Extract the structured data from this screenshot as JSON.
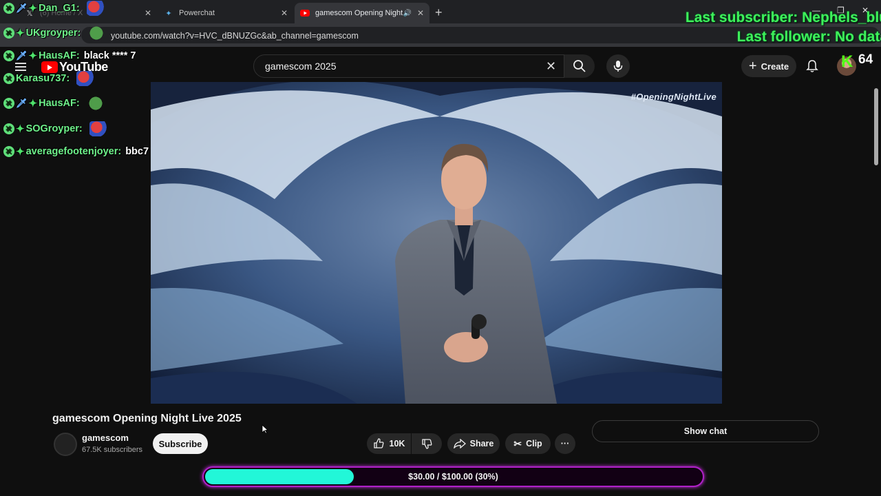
{
  "browser": {
    "tabs": [
      {
        "title": "(6) Home / X",
        "favicon": "x-icon"
      },
      {
        "title": "Powerchat",
        "favicon": "powerchat-icon"
      },
      {
        "title": "gamescom Opening Night",
        "favicon": "youtube-icon",
        "active": true
      }
    ],
    "url": "youtube.com/watch?v=HVC_dBNUZGc&ab_channel=gamescom"
  },
  "chat": [
    {
      "user": "Dan_G1:",
      "text": "",
      "emote": "mario"
    },
    {
      "user": "UKgroyper:",
      "text": "",
      "emote": "pepe"
    },
    {
      "user": "HausAF:",
      "text": "black **** 7",
      "emote": ""
    },
    {
      "user": "Karasu737:",
      "text": "",
      "emote": "mario"
    },
    {
      "user": "HausAF:",
      "text": "",
      "emote": "pepe"
    },
    {
      "user": "SOGroyper:",
      "text": "",
      "emote": "mario"
    },
    {
      "user": "averagefootenjoyer:",
      "text": "bbc7",
      "emote": ""
    }
  ],
  "overlay": {
    "last_subscriber": "Last subscriber: Nephels_blu",
    "last_follower": "Last follower: No data",
    "viewer_count": "64",
    "goal_text": "$30.00 / $100.00 (30%)",
    "goal_progress": 0.3
  },
  "youtube": {
    "logo_text": "YouTube",
    "search_value": "gamescom 2025",
    "create_label": "Create",
    "video": {
      "hashtag": "#OpeningNightLive",
      "title": "gamescom Opening Night Live 2025",
      "channel": "gamescom",
      "subscribers": "67.5K subscribers",
      "subscribe_label": "Subscribe",
      "likes": "10K",
      "share_label": "Share",
      "clip_label": "Clip"
    },
    "show_chat_label": "Show chat"
  }
}
